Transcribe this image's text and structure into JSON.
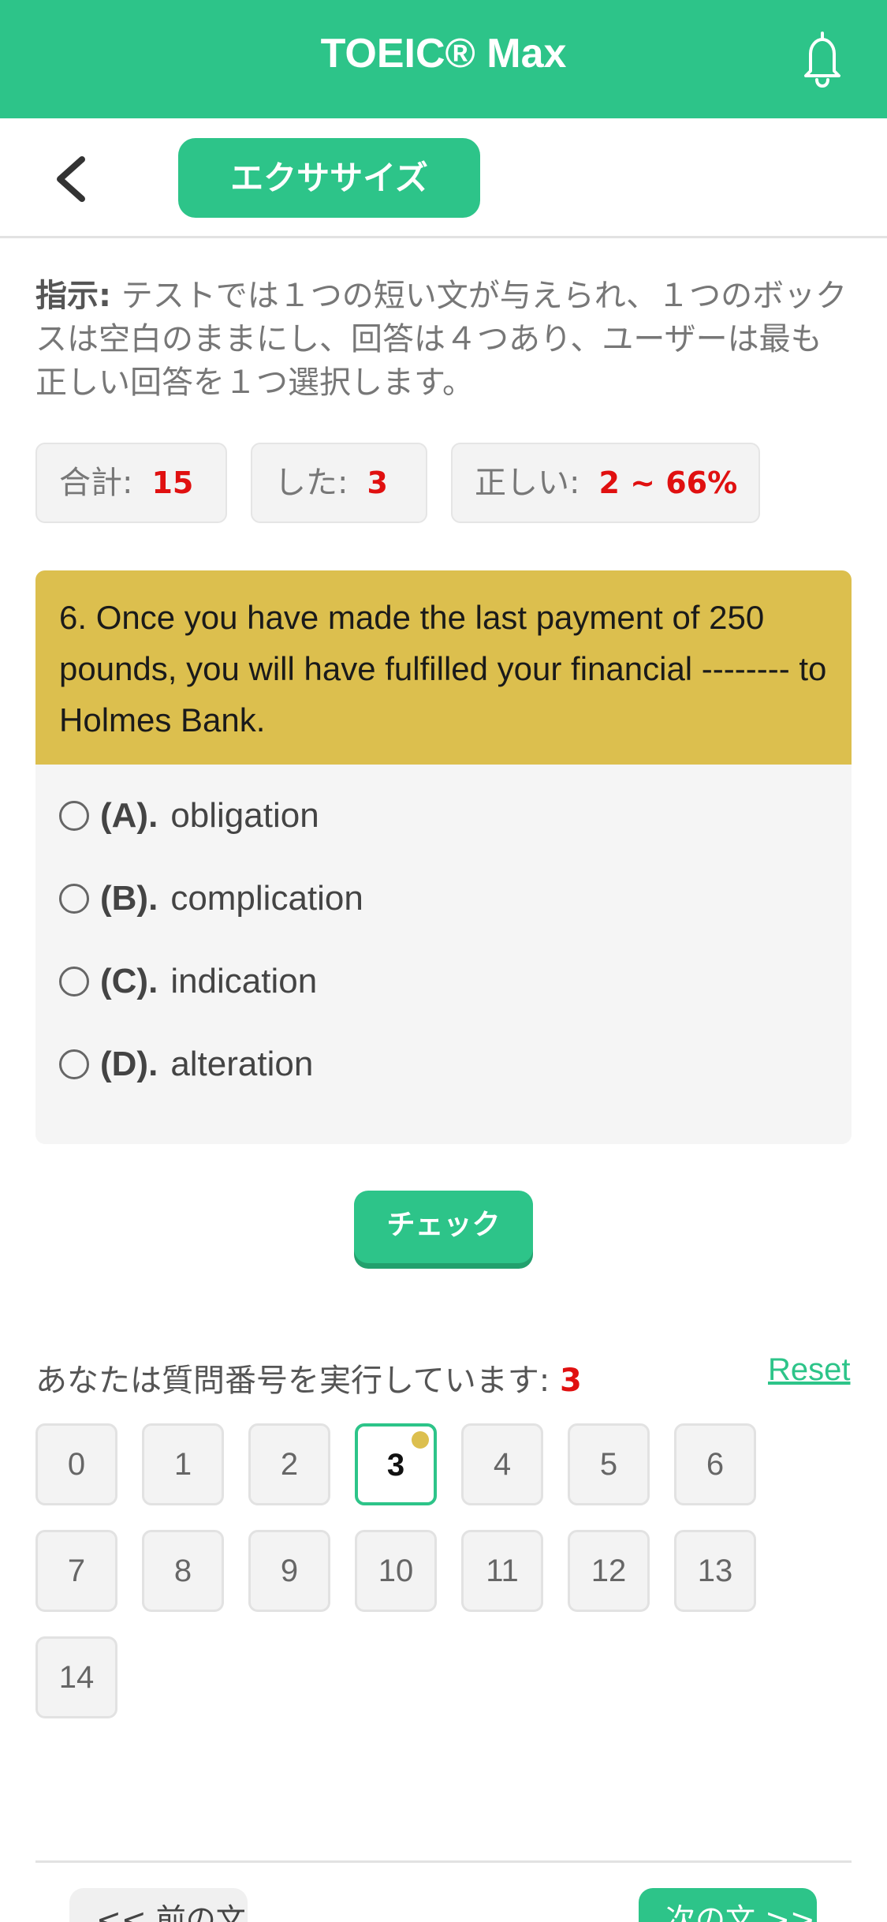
{
  "header": {
    "title": "TOEIC® Max",
    "notification_icon": "bell-icon",
    "bg_color": "#2dc489"
  },
  "subheader": {
    "back_icon": "chevron-left-icon",
    "exercise_label": "エクササイズ"
  },
  "instruction": {
    "label": "指示:",
    "text": " テストでは１つの短い文が与えられ、１つのボックスは空白のままにし、回答は４つあり、ユーザーは最も正しい回答を１つ選択します。"
  },
  "stats": {
    "total_label": "合計:",
    "total_value": "15",
    "done_label": "した:",
    "done_value": "3",
    "correct_label": "正しい:",
    "correct_value": "2 ~ 66%"
  },
  "question": {
    "text": "6. Once you have made the last payment of 250 pounds, you will have fulfilled your financial -------- to Holmes Bank.",
    "options": [
      {
        "letter": "(A).",
        "text": "obligation"
      },
      {
        "letter": "(B).",
        "text": "complication"
      },
      {
        "letter": "(C).",
        "text": "indication"
      },
      {
        "letter": "(D).",
        "text": "alteration"
      }
    ]
  },
  "check_label": "チェック",
  "progress": {
    "label": "あなたは質問番号を実行しています:",
    "current": "3",
    "reset_label": "Reset",
    "numbers": [
      "0",
      "1",
      "2",
      "3",
      "4",
      "5",
      "6",
      "7",
      "8",
      "9",
      "10",
      "11",
      "12",
      "13",
      "14"
    ]
  },
  "nav": {
    "prev_label": "<< 前の文",
    "next_label": "次の文 >>"
  }
}
